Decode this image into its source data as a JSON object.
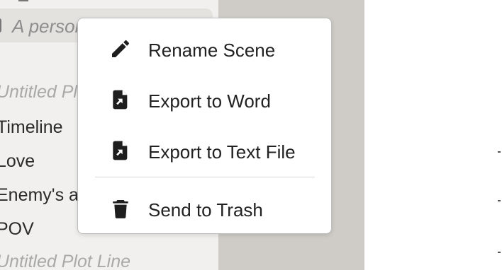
{
  "sidebar": {
    "selected_scene": {
      "title": "A personal battle",
      "icon": "document-icon",
      "more_icon": "kebab-menu-icon"
    },
    "items": [
      {
        "label": "Untitled Plot Line",
        "muted": true
      },
      {
        "label": "Timeline",
        "muted": false
      },
      {
        "label": "Love",
        "muted": false
      },
      {
        "label": "Enemy's army",
        "muted": false
      },
      {
        "label": "POV",
        "muted": false
      },
      {
        "label": "Untitled Plot Line",
        "muted": true
      }
    ]
  },
  "context_menu": {
    "items": [
      {
        "label": "Rename Scene",
        "icon": "pencil-icon"
      },
      {
        "label": "Export to Word",
        "icon": "file-export-icon"
      },
      {
        "label": "Export to Text File",
        "icon": "file-export-icon"
      },
      {
        "label": "Send to Trash",
        "icon": "trash-icon"
      }
    ]
  },
  "colors": {
    "sidebar_bg": "#f1f0ef",
    "selected_row_bg": "#e4e2df",
    "gutter_bg": "#cfccc7",
    "menu_bg": "#ffffff",
    "muted_text": "#a9a9a9",
    "text": "#222222"
  }
}
